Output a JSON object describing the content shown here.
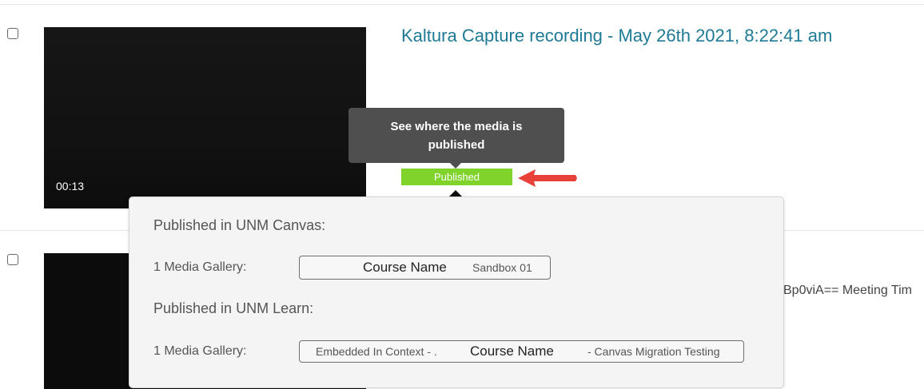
{
  "entries": [
    {
      "duration": "00:13",
      "title": "Kaltura Capture recording - May 26th 2021, 8:22:41 am",
      "status_badge": "Published",
      "tooltip": "See where the media is published"
    },
    {
      "meta_text": "Bp0viA== Meeting Tim"
    }
  ],
  "popover": {
    "sections": [
      {
        "title": "Published in UNM Canvas:",
        "gallery_label": "1 Media Gallery:",
        "course_name": "Course Name",
        "course_suffix": "Sandbox 01"
      },
      {
        "title": "Published in UNM Learn:",
        "gallery_label": "1 Media Gallery:",
        "course_prefix": "Embedded In Context - .",
        "course_name": "Course Name",
        "course_suffix": "- Canvas Migration Testing"
      }
    ]
  },
  "colors": {
    "title_link": "#1f7a96",
    "published_green": "#7fd32a",
    "tooltip_bg": "#4f4f4f",
    "annotation_arrow": "#e8413a"
  }
}
